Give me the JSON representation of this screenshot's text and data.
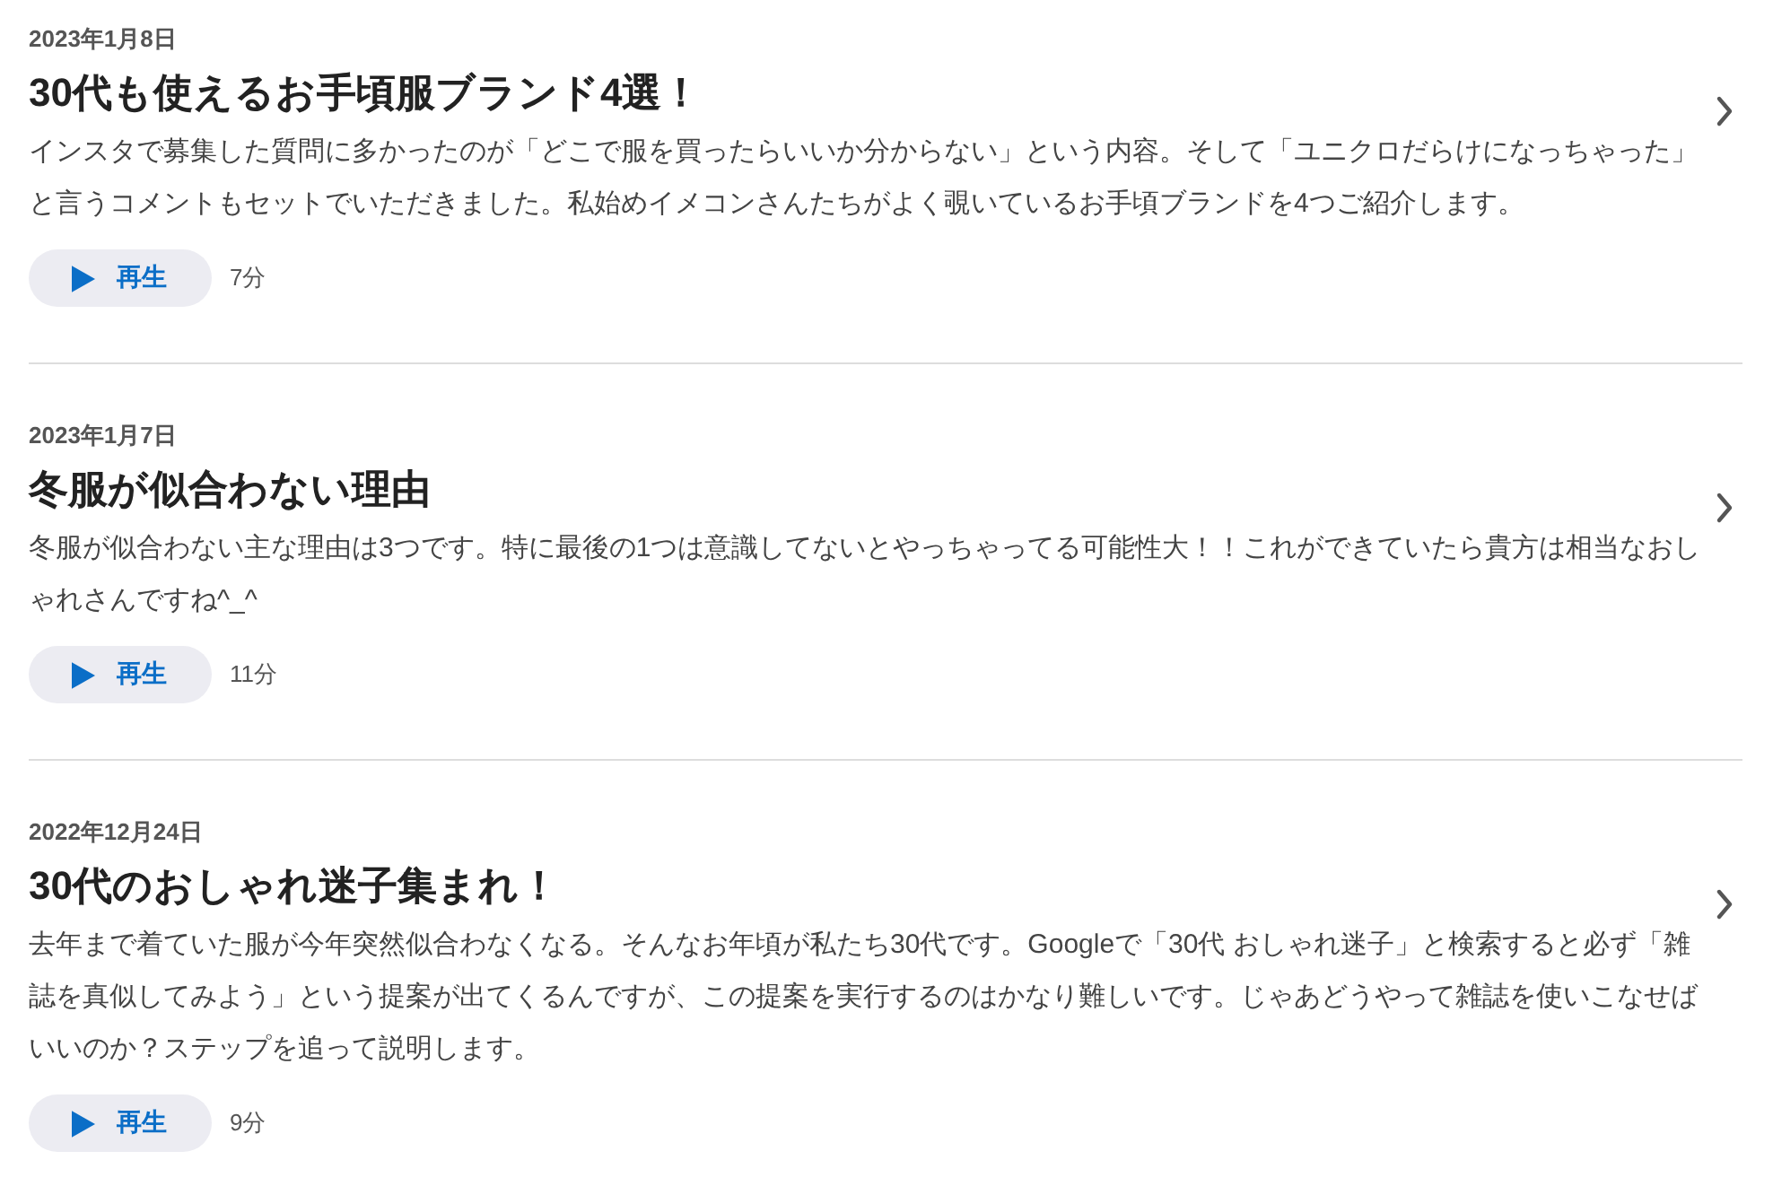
{
  "episodes": [
    {
      "date": "2023年1月8日",
      "title": "30代も使えるお手頃服ブランド4選！",
      "description": "インスタで募集した質問に多かったのが「どこで服を買ったらいいか分からない」という内容。そして「ユニクロだらけになっちゃった」と言うコメントもセットでいただきました。私始めイメコンさんたちがよく覗いているお手頃ブランドを4つご紹介します。",
      "play_label": "再生",
      "duration": "7分"
    },
    {
      "date": "2023年1月7日",
      "title": "冬服が似合わない理由",
      "description": "冬服が似合わない主な理由は3つです。特に最後の1つは意識してないとやっちゃってる可能性大！！これができていたら貴方は相当なおしゃれさんですね^_^",
      "play_label": "再生",
      "duration": "11分"
    },
    {
      "date": "2022年12月24日",
      "title": "30代のおしゃれ迷子集まれ！",
      "description": "去年まで着ていた服が今年突然似合わなくなる。そんなお年頃が私たち30代です。Googleで「30代 おしゃれ迷子」と検索すると必ず「雑誌を真似してみよう」という提案が出てくるんですが、この提案を実行するのはかなり難しいです。じゃあどうやって雑誌を使いこなせばいいのか？ステップを追って説明します。",
      "play_label": "再生",
      "duration": "9分"
    }
  ]
}
